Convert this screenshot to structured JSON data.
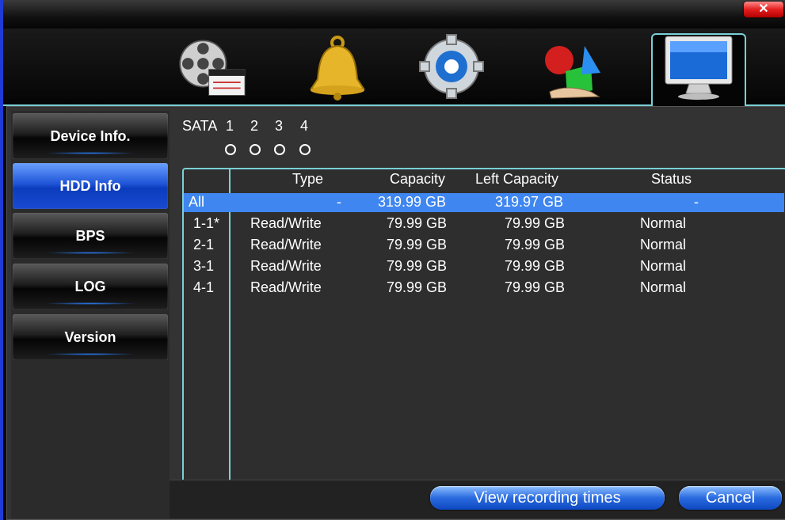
{
  "window": {
    "close_glyph": "✕"
  },
  "nav_icons": [
    {
      "name": "record-film-icon"
    },
    {
      "name": "alarm-bell-icon"
    },
    {
      "name": "settings-gear-icon"
    },
    {
      "name": "advanced-shapes-icon"
    },
    {
      "name": "system-monitor-icon",
      "active": true
    }
  ],
  "sidebar": {
    "items": [
      {
        "label": "Device Info."
      },
      {
        "label": "HDD Info"
      },
      {
        "label": "BPS"
      },
      {
        "label": "LOG"
      },
      {
        "label": "Version"
      }
    ]
  },
  "sata": {
    "label": "SATA",
    "ports": [
      "1",
      "2",
      "3",
      "4"
    ]
  },
  "table": {
    "headers": [
      "Type",
      "Capacity",
      "Left Capacity",
      "Status"
    ],
    "rows": [
      {
        "id": "All",
        "type": "-",
        "capacity": "319.99 GB",
        "left": "319.97 GB",
        "status": "-"
      },
      {
        "id": "1-1*",
        "type": "Read/Write",
        "capacity": "79.99 GB",
        "left": "79.99 GB",
        "status": "Normal"
      },
      {
        "id": "2-1",
        "type": "Read/Write",
        "capacity": "79.99 GB",
        "left": "79.99 GB",
        "status": "Normal"
      },
      {
        "id": "3-1",
        "type": "Read/Write",
        "capacity": "79.99 GB",
        "left": "79.99 GB",
        "status": "Normal"
      },
      {
        "id": "4-1",
        "type": "Read/Write",
        "capacity": "79.99 GB",
        "left": "79.99 GB",
        "status": "Normal"
      }
    ]
  },
  "buttons": {
    "view": "View recording times",
    "cancel": "Cancel"
  },
  "colors": {
    "accent": "#3f86f0",
    "border": "#7ad0d6",
    "close": "#e31e1e"
  }
}
